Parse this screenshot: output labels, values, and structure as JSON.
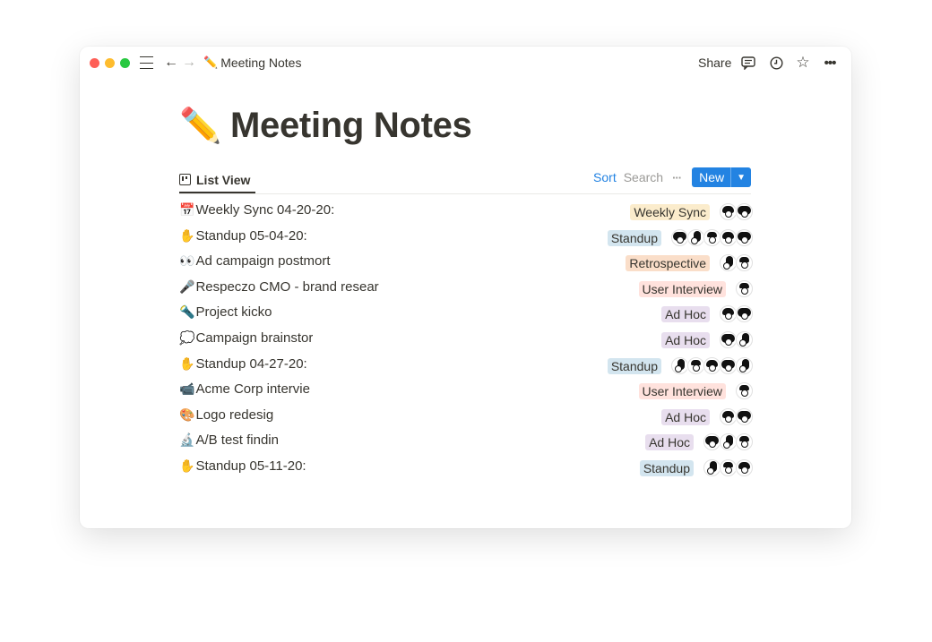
{
  "window": {
    "breadcrumb_emoji": "✏️",
    "breadcrumb": "Meeting Notes",
    "share_label": "Share"
  },
  "page": {
    "title_emoji": "✏️",
    "title": "Meeting Notes"
  },
  "view": {
    "tab_label": "List View",
    "sort_label": "Sort",
    "search_label": "Search",
    "more_label": "···",
    "new_label": "New"
  },
  "rows": [
    {
      "emoji": "📅",
      "name": "Weekly Sync 04-20-20:",
      "tag": "Weekly Sync",
      "tag_class": "weekly",
      "avatars": 2
    },
    {
      "emoji": "✋",
      "name": "Standup 05-04-20:",
      "tag": "Standup",
      "tag_class": "standup",
      "avatars": 5
    },
    {
      "emoji": "👀",
      "name": "Ad campaign postmort",
      "tag": "Retrospective",
      "tag_class": "retro",
      "avatars": 2
    },
    {
      "emoji": "🎤",
      "name": "Respeczo CMO - brand resear",
      "tag": "User Interview",
      "tag_class": "interview",
      "avatars": 1
    },
    {
      "emoji": "🔦",
      "name": "Project kicko",
      "tag": "Ad Hoc",
      "tag_class": "adhoc",
      "avatars": 2
    },
    {
      "emoji": "💭",
      "name": "Campaign brainstor",
      "tag": "Ad Hoc",
      "tag_class": "adhoc",
      "avatars": 2
    },
    {
      "emoji": "✋",
      "name": "Standup 04-27-20:",
      "tag": "Standup",
      "tag_class": "standup",
      "avatars": 5
    },
    {
      "emoji": "📹",
      "name": "Acme Corp intervie",
      "tag": "User Interview",
      "tag_class": "interview",
      "avatars": 1
    },
    {
      "emoji": "🎨",
      "name": "Logo redesig",
      "tag": "Ad Hoc",
      "tag_class": "adhoc",
      "avatars": 2
    },
    {
      "emoji": "🔬",
      "name": "A/B test findin",
      "tag": "Ad Hoc",
      "tag_class": "adhoc",
      "avatars": 3
    },
    {
      "emoji": "✋",
      "name": "Standup 05-11-20:",
      "tag": "Standup",
      "tag_class": "standup",
      "avatars": 3
    }
  ]
}
